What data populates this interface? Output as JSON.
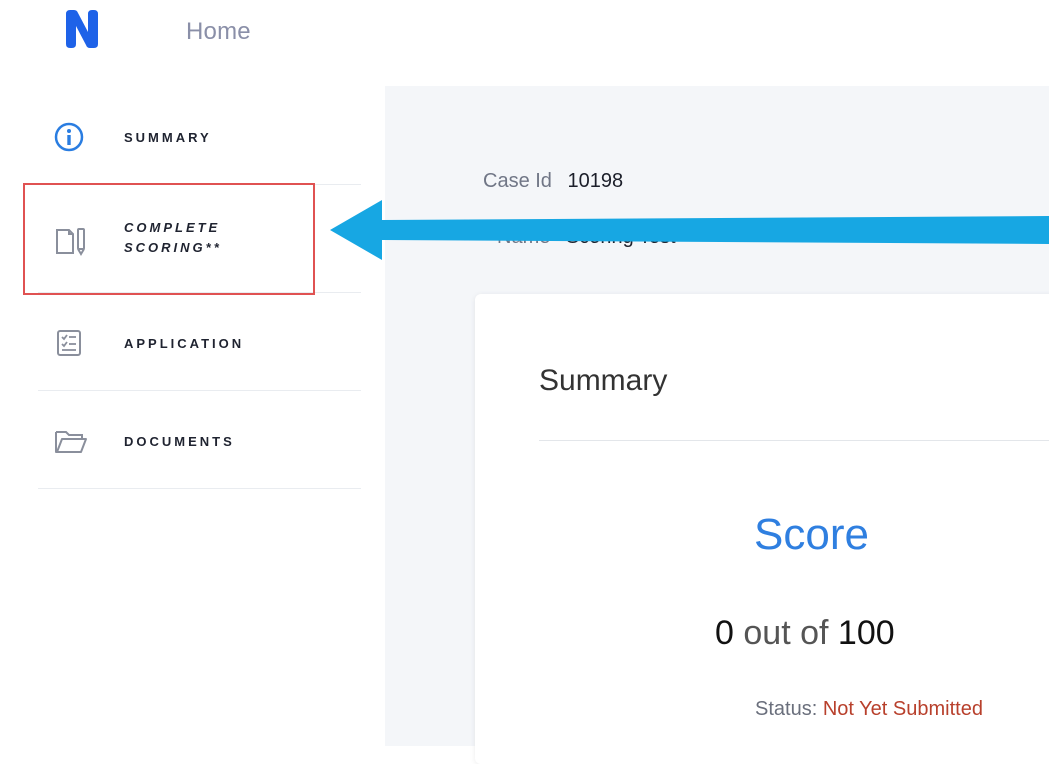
{
  "header": {
    "logo_letter": "N",
    "home_label": "Home"
  },
  "sidebar": {
    "items": [
      {
        "label": "SUMMARY",
        "icon": "info-circle-icon"
      },
      {
        "label": "COMPLETE\nSCORING**",
        "icon": "document-pen-icon"
      },
      {
        "label": "APPLICATION",
        "icon": "checklist-icon"
      },
      {
        "label": "DOCUMENTS",
        "icon": "folder-icon"
      }
    ]
  },
  "case": {
    "case_id_label": "Case Id",
    "case_id_value": "10198",
    "name_label": "Name",
    "name_value": "Scoring Test"
  },
  "summary_card": {
    "title": "Summary",
    "score_heading": "Score",
    "score_value": "0",
    "score_out_of": "out of",
    "score_max": "100",
    "status_label": "Status:",
    "status_value": "Not Yet Submitted"
  },
  "colors": {
    "accent": "#2f7fe0",
    "logo": "#1e62e8",
    "highlight_box": "#e05252",
    "arrow": "#17a7e3",
    "status_value": "#b8402c"
  }
}
